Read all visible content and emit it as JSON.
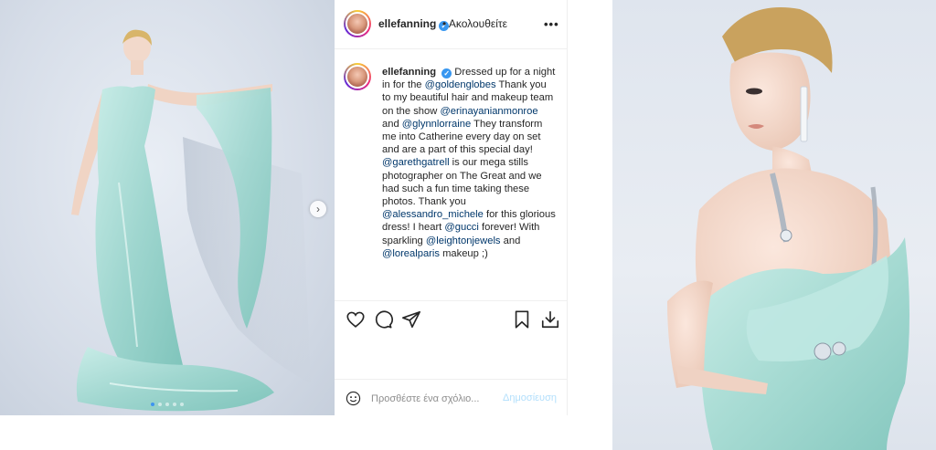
{
  "post": {
    "username": "ellefanning",
    "verified_mark": "✓",
    "follow_label": "• Ακολουθείτε",
    "more_label": "•••",
    "next_arrow": "›"
  },
  "caption": {
    "username": "ellefanning",
    "segments": [
      {
        "text": " Dressed up for a night in for the "
      },
      {
        "text": "@goldenglobes",
        "link": true
      },
      {
        "text": " Thank you to my beautiful hair and makeup team on the show "
      },
      {
        "text": "@erinayanianmonroe",
        "link": true
      },
      {
        "text": " and "
      },
      {
        "text": "@glynnlorraine",
        "link": true
      },
      {
        "text": " They transform me into Catherine every day on set and are a part of this special day! "
      },
      {
        "text": "@garethgatrell",
        "link": true
      },
      {
        "text": " is our mega stills photographer on The Great and we had such a fun time taking these photos. Thank you "
      },
      {
        "text": "@alessandro_michele",
        "link": true
      },
      {
        "text": " for this glorious dress! I heart "
      },
      {
        "text": "@gucci",
        "link": true
      },
      {
        "text": " forever! With sparkling "
      },
      {
        "text": "@leightonjewels",
        "link": true
      },
      {
        "text": " and "
      },
      {
        "text": "@lorealparis",
        "link": true
      },
      {
        "text": " makeup ;)"
      }
    ]
  },
  "actions": {
    "icons": [
      "heart-icon",
      "comment-icon",
      "share-icon",
      "bookmark-icon",
      "download-icon"
    ]
  },
  "comment": {
    "placeholder": "Προσθέστε ένα σχόλιο...",
    "post_label": "Δημοσίευση"
  },
  "carousel": {
    "slide_count": 5,
    "active_index": 0
  },
  "colors": {
    "link": "#00376b",
    "verified": "#3897f0",
    "dress": "#a8dcd6",
    "active_dot": "#3e94f0"
  }
}
